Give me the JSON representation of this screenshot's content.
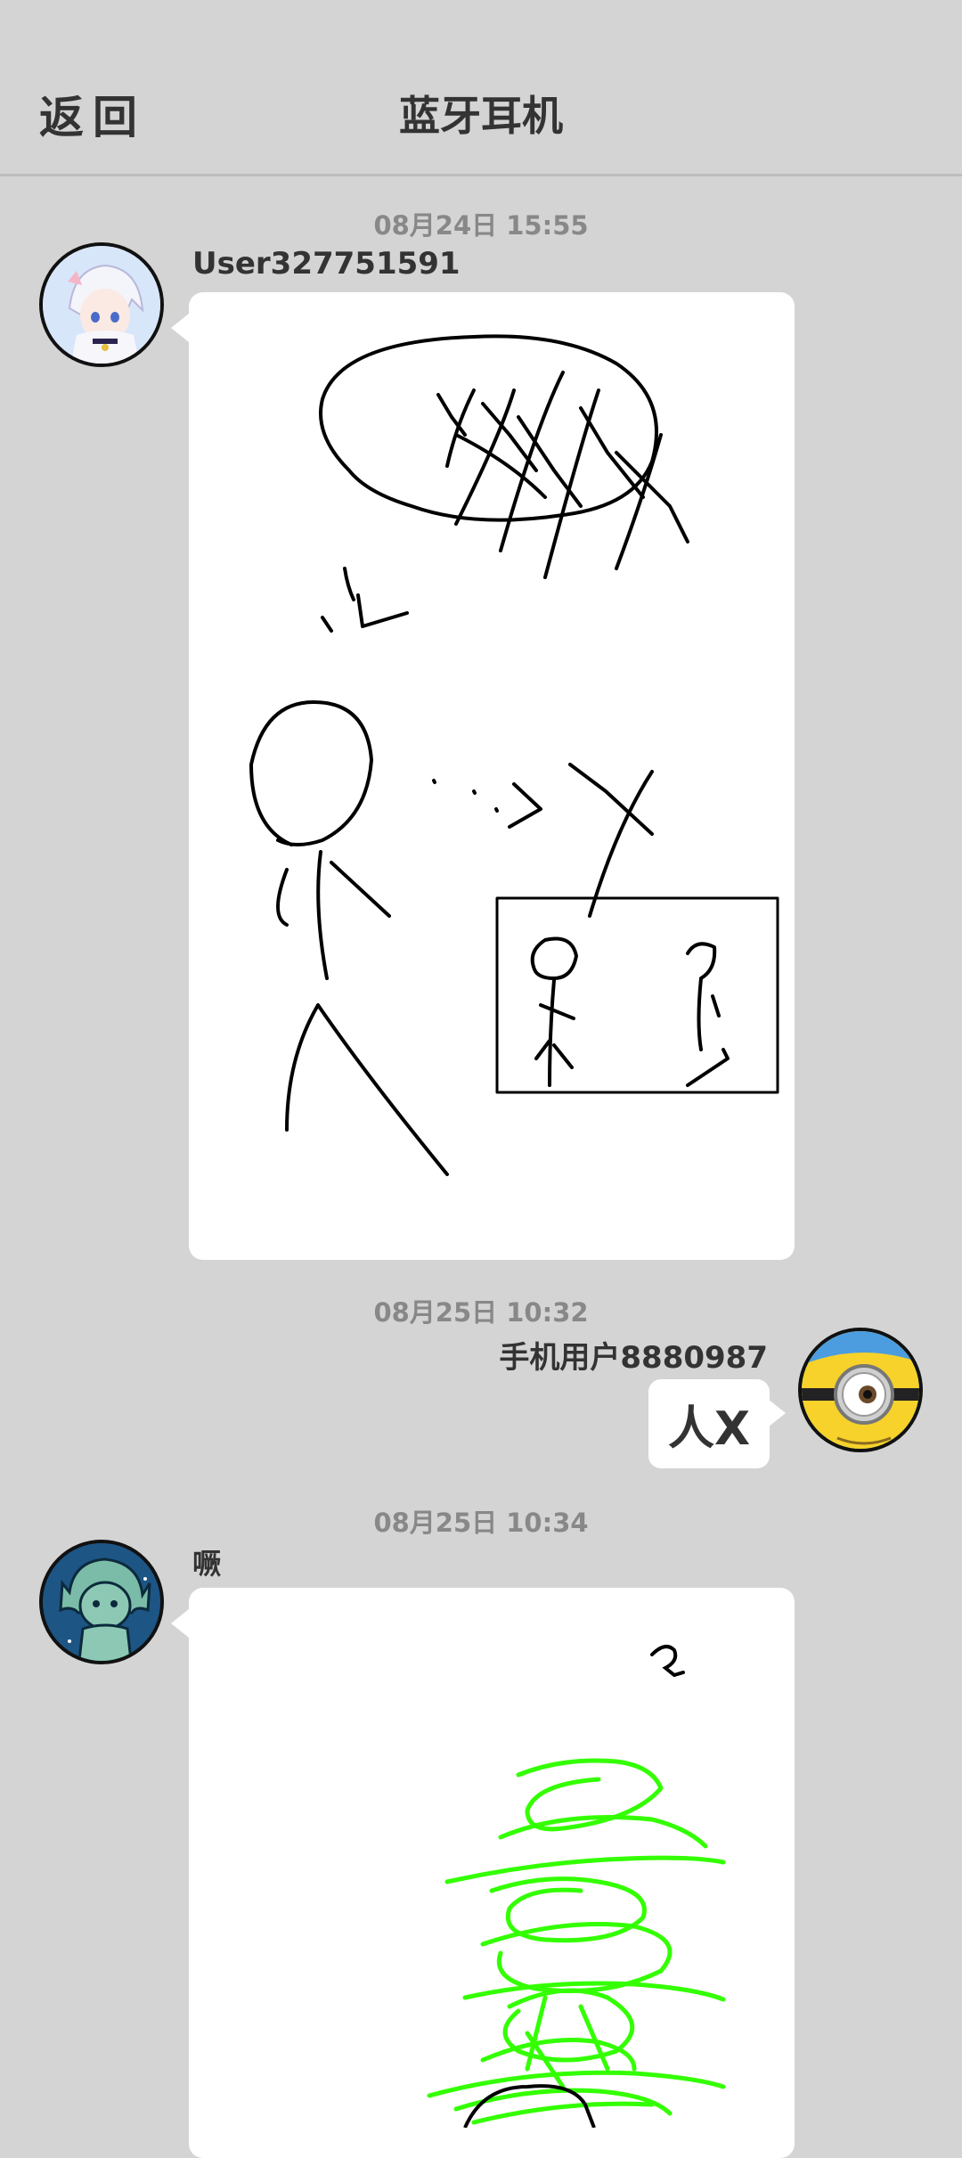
{
  "header": {
    "back_label": "返回",
    "title": "蓝牙耳机"
  },
  "messages": [
    {
      "time": "08月24日  15:55",
      "sender": "User327751591",
      "type": "drawing"
    },
    {
      "time": "08月25日  10:32",
      "sender": "手机用户8880987",
      "type": "text",
      "text": "人X"
    },
    {
      "time": "08月25日  10:34",
      "sender": "噘",
      "type": "drawing"
    }
  ],
  "colors": {
    "background": "#d4d4d4",
    "bubble": "#ffffff",
    "green_scribble": "#33ff00"
  },
  "icons": [
    "user-avatar-anime",
    "minion-avatar",
    "green-character-avatar"
  ]
}
